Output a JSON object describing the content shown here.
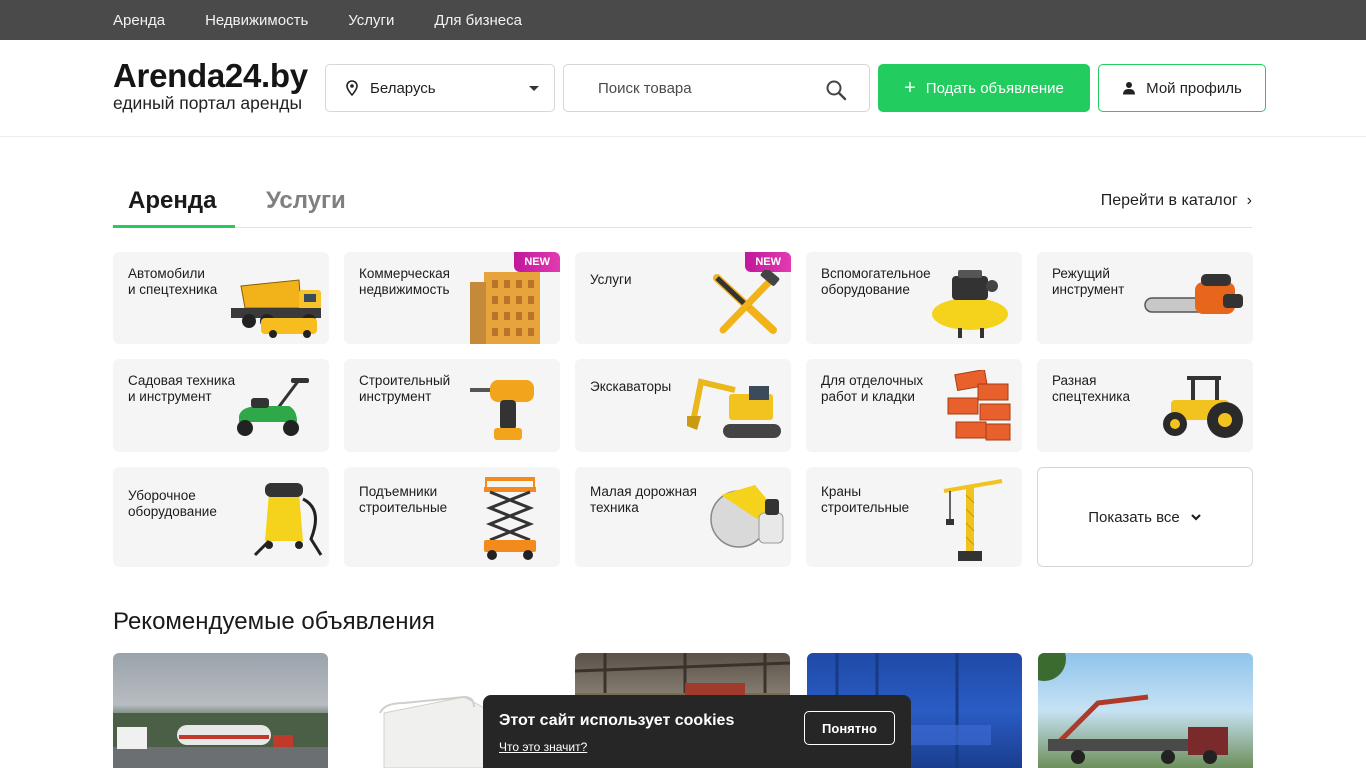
{
  "topnav": [
    "Аренда",
    "Недвижимость",
    "Услуги",
    "Для бизнеса"
  ],
  "logo": {
    "name": "Arenda24.by",
    "tagline": "единый портал аренды"
  },
  "region": {
    "selected": "Беларусь"
  },
  "search": {
    "placeholder": "Поиск товара"
  },
  "buttons": {
    "post_ad": "Подать объявление",
    "profile": "Мой профиль"
  },
  "tabs": [
    {
      "label": "Аренда",
      "active": true
    },
    {
      "label": "Услуги",
      "active": false
    }
  ],
  "catalog_link": "Перейти в каталог",
  "categories": [
    {
      "label": "Автомобили\nи спецтехника",
      "icon": "dump-truck-icon"
    },
    {
      "label": "Коммерческая\nнедвижимость",
      "icon": "building-icon",
      "badge": "NEW"
    },
    {
      "label": "Услуги",
      "icon": "tools-icon",
      "badge": "NEW"
    },
    {
      "label": "Вспомогательное\nоборудование",
      "icon": "compressor-icon"
    },
    {
      "label": "Режущий\nинструмент",
      "icon": "chainsaw-icon"
    },
    {
      "label": "Садовая техника\nи инструмент",
      "icon": "lawnmower-icon"
    },
    {
      "label": "Строительный\nинструмент",
      "icon": "drill-icon"
    },
    {
      "label": "Экскаваторы",
      "icon": "excavator-icon"
    },
    {
      "label": "Для отделочных\nработ и кладки",
      "icon": "bricks-icon"
    },
    {
      "label": "Разная\nспецтехника",
      "icon": "tractor-icon"
    },
    {
      "label": "Уборочное\nоборудование",
      "icon": "vacuum-icon"
    },
    {
      "label": "Подъемники\nстроительные",
      "icon": "scissor-lift-icon"
    },
    {
      "label": "Малая дорожная\nтехника",
      "icon": "road-saw-icon"
    },
    {
      "label": "Краны\nстроительные",
      "icon": "crane-icon"
    }
  ],
  "show_all": "Показать все",
  "recommended_title": "Рекомендуемые объявления",
  "cookie": {
    "title": "Этот сайт использует cookies",
    "more": "Что это значит?",
    "ok": "Понятно"
  },
  "colors": {
    "accent": "#22cc5e",
    "topbar": "#4a4a4a",
    "badge": "#d12aa8"
  }
}
